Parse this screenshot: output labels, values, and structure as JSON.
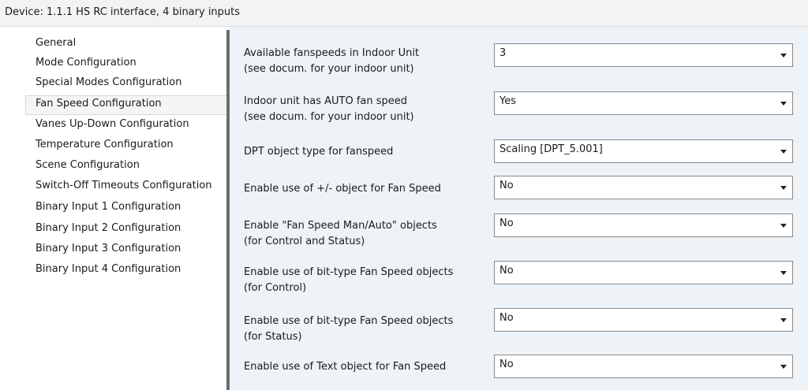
{
  "window": {
    "title": "Device: 1.1.1  HS RC interface, 4 binary inputs"
  },
  "sidebar": {
    "items": [
      {
        "label": "General",
        "selected": false
      },
      {
        "label": "Mode Configuration",
        "selected": false
      },
      {
        "label": "Special Modes Configuration",
        "selected": false
      },
      {
        "label": "Fan Speed Configuration",
        "selected": true
      },
      {
        "label": "Vanes Up-Down Configuration",
        "selected": false
      },
      {
        "label": "Temperature Configuration",
        "selected": false
      },
      {
        "label": "Scene Configuration",
        "selected": false
      },
      {
        "label": "Switch-Off Timeouts Configuration",
        "selected": false
      },
      {
        "label": "Binary Input 1 Configuration",
        "selected": false
      },
      {
        "label": "Binary Input 2 Configuration",
        "selected": false
      },
      {
        "label": "Binary Input 3 Configuration",
        "selected": false
      },
      {
        "label": "Binary Input 4 Configuration",
        "selected": false
      }
    ]
  },
  "params": [
    {
      "label_line1": "Available fanspeeds in Indoor Unit",
      "label_line2": "(see docum. for your indoor unit)",
      "value": "3"
    },
    {
      "label_line1": "Indoor unit has AUTO fan speed",
      "label_line2": "(see docum. for your indoor unit)",
      "value": "Yes"
    },
    {
      "label_line1": "DPT object type for fanspeed",
      "label_line2": "",
      "value": "Scaling [DPT_5.001]"
    },
    {
      "label_line1": "Enable use of +/- object for Fan Speed",
      "label_line2": "",
      "value": "No"
    },
    {
      "label_line1": "Enable \"Fan Speed Man/Auto\" objects",
      "label_line2": "(for Control and Status)",
      "value": "No"
    },
    {
      "label_line1": "Enable use of bit-type Fan Speed objects",
      "label_line2": "(for Control)",
      "value": "No"
    },
    {
      "label_line1": "Enable use of bit-type Fan Speed objects",
      "label_line2": "(for Status)",
      "value": "No"
    },
    {
      "label_line1": "Enable use of Text object for Fan Speed",
      "label_line2": "",
      "value": "No"
    }
  ],
  "icons": {
    "dropdown": "chevron-down-icon"
  },
  "colors": {
    "content_bg": "#eef3f8",
    "splitter": "#6d6d6d",
    "selected_bg": "#f5f5f5"
  }
}
